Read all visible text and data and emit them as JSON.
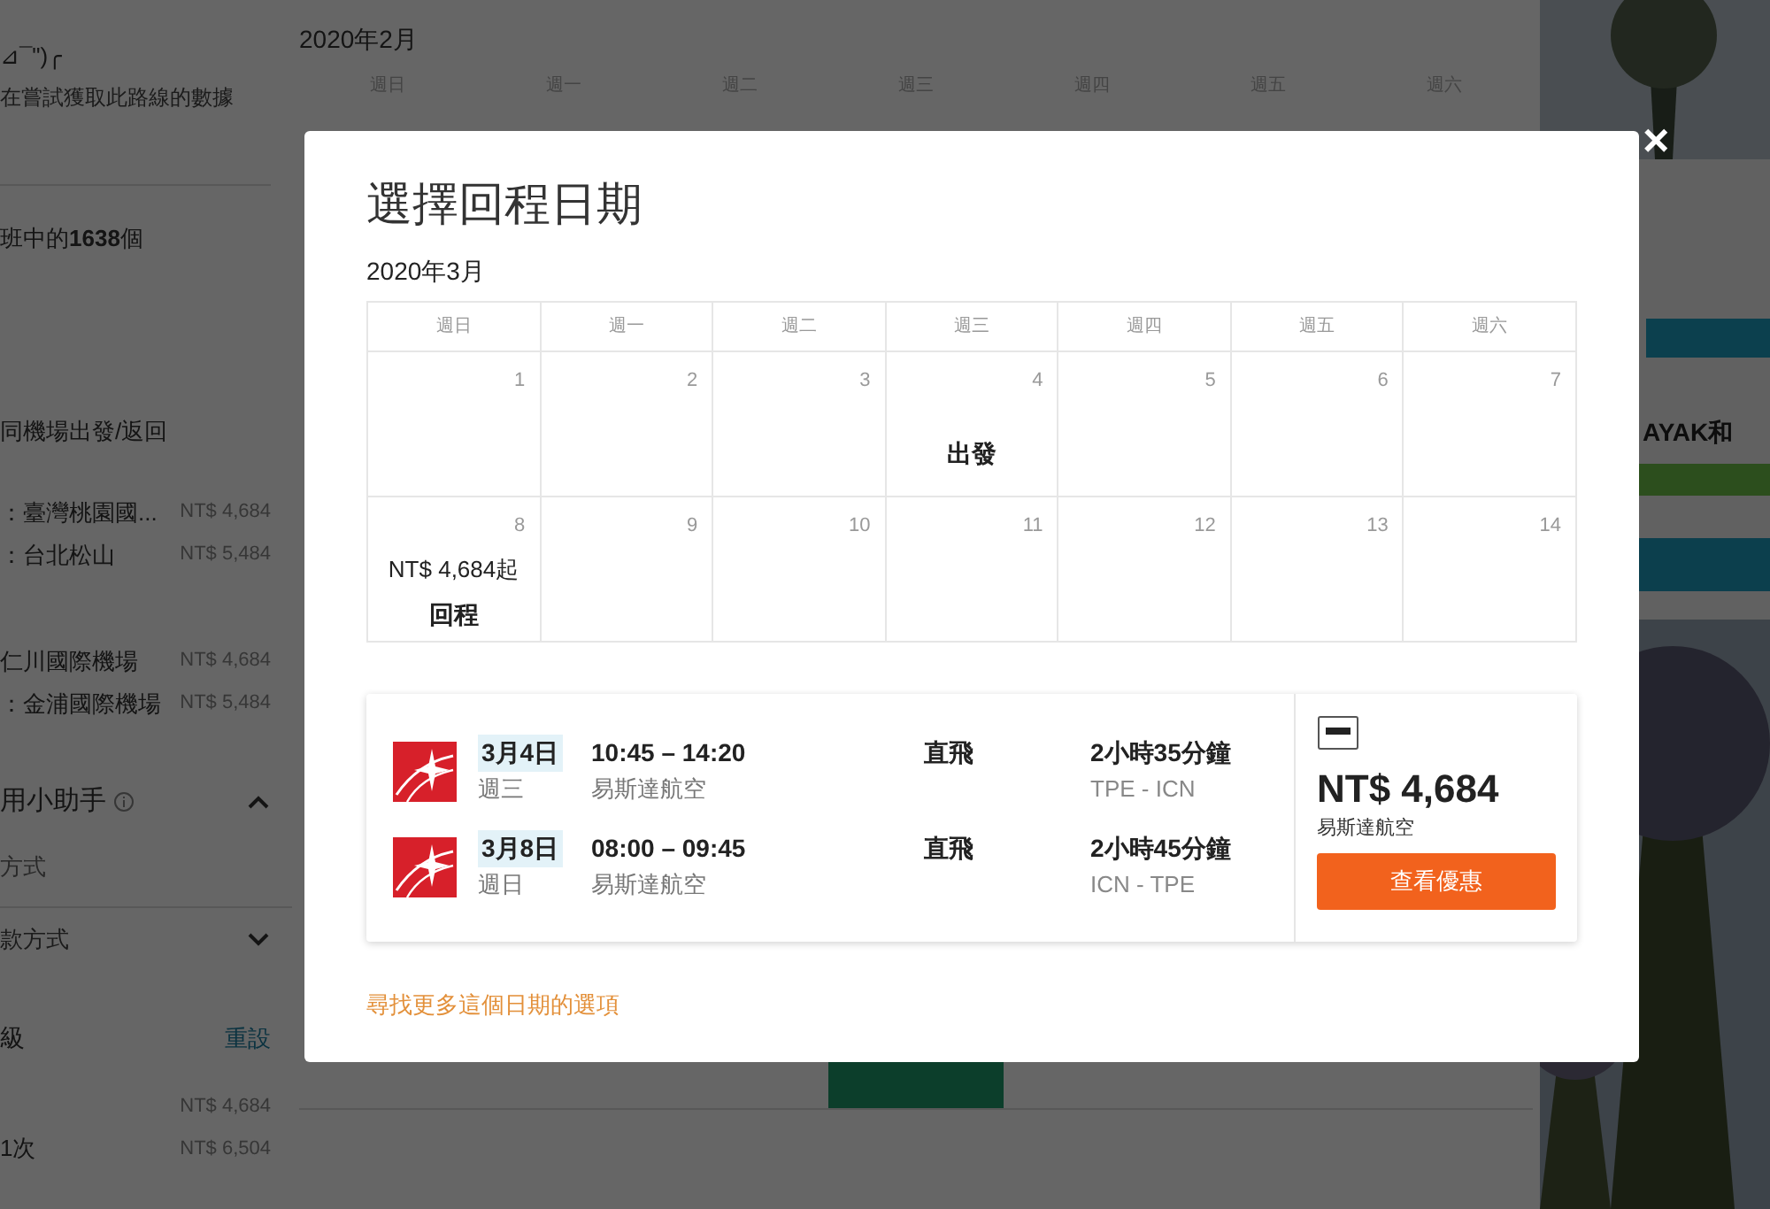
{
  "background": {
    "left_panel": {
      "emoticon": "⊿¯\")╭",
      "notice": "在嘗試獲取此路線的數據",
      "summary": "班中的**1638**個",
      "airport_heading": "同機場出發/返回",
      "airports": [
        {
          "name": "：臺灣桃園國...",
          "price": "NT$ 4,684"
        },
        {
          "name": "：台北松山",
          "price": "NT$ 5,484"
        },
        {
          "name": "仁川國際機場",
          "price": "NT$ 4,684"
        },
        {
          "name": "：金浦國際機場",
          "price": "NT$ 5,484"
        }
      ],
      "helper": "用小助手",
      "method_label": "方式",
      "method_select": "款方式",
      "class_label": "級",
      "reset": "重設",
      "stops": [
        {
          "price": "NT$ 4,684"
        },
        {
          "name": "1次",
          "price": "NT$ 6,504"
        }
      ]
    },
    "calendar": {
      "month": "2020年2月",
      "weekdays": [
        "週日",
        "週一",
        "週二",
        "週三",
        "週四",
        "週五",
        "週六"
      ]
    },
    "ad": {
      "text": "AYAK和"
    }
  },
  "modal": {
    "title": "選擇回程日期",
    "month": "2020年3月",
    "weekdays": [
      "週日",
      "週一",
      "週二",
      "週三",
      "週四",
      "週五",
      "週六"
    ],
    "weeks": [
      [
        {
          "day": "1"
        },
        {
          "day": "2"
        },
        {
          "day": "3"
        },
        {
          "day": "4",
          "labels": [
            {
              "kind": "tag",
              "text": "出發"
            }
          ]
        },
        {
          "day": "5"
        },
        {
          "day": "6"
        },
        {
          "day": "7"
        }
      ],
      [
        {
          "day": "8",
          "labels": [
            {
              "kind": "price",
              "text": "NT$ 4,684起"
            },
            {
              "kind": "tag",
              "text": "回程"
            }
          ]
        },
        {
          "day": "9"
        },
        {
          "day": "10"
        },
        {
          "day": "11"
        },
        {
          "day": "12"
        },
        {
          "day": "13"
        },
        {
          "day": "14"
        }
      ]
    ],
    "flight": {
      "legs": [
        {
          "date": "3月4日",
          "weekday": "週三",
          "times": "10:45 – 14:20",
          "airline": "易斯達航空",
          "stops": "直飛",
          "duration": "2小時35分鐘",
          "route": "TPE - ICN"
        },
        {
          "date": "3月8日",
          "weekday": "週日",
          "times": "08:00 – 09:45",
          "airline": "易斯達航空",
          "stops": "直飛",
          "duration": "2小時45分鐘",
          "route": "ICN - TPE"
        }
      ],
      "price": "NT$ 4,684",
      "airline": "易斯達航空",
      "button": "查看優惠"
    },
    "more_link": "尋找更多這個日期的選項",
    "close": "×"
  }
}
